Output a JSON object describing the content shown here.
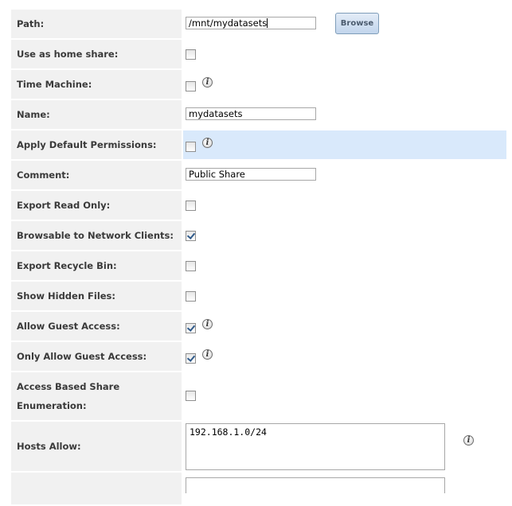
{
  "fields": {
    "path": {
      "label": "Path:",
      "value": "/mnt/mydatasets",
      "browse_label": "Browse"
    },
    "home_share": {
      "label": "Use as home share:",
      "checked": false
    },
    "time_machine": {
      "label": "Time Machine:",
      "checked": false
    },
    "name": {
      "label": "Name:",
      "value": "mydatasets"
    },
    "default_permissions": {
      "label": "Apply Default Permissions:",
      "checked": false
    },
    "comment": {
      "label": "Comment:",
      "value": "Public Share"
    },
    "export_read_only": {
      "label": "Export Read Only:",
      "checked": false
    },
    "browsable": {
      "label": "Browsable to Network Clients:",
      "checked": true
    },
    "recycle_bin": {
      "label": "Export Recycle Bin:",
      "checked": false
    },
    "hidden_files": {
      "label": "Show Hidden Files:",
      "checked": false
    },
    "guest_access": {
      "label": "Allow Guest Access:",
      "checked": true
    },
    "guest_only": {
      "label": "Only Allow Guest Access:",
      "checked": true
    },
    "abse": {
      "label_line1": "Access Based Share",
      "label_line2": "Enumeration:",
      "checked": false
    },
    "hosts_allow": {
      "label": "Hosts Allow:",
      "value": "192.168.1.0/24"
    }
  },
  "icons": {
    "info": "info-icon",
    "checkbox_checked": "check-icon"
  },
  "colors": {
    "label_bg": "#f1f1f1",
    "highlight_bg": "#d9e9fb",
    "button_bg": "#c2d5ec"
  }
}
